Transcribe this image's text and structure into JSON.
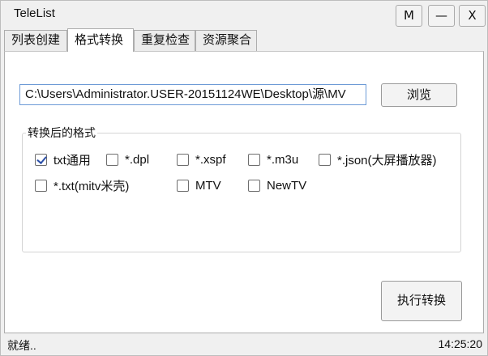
{
  "window": {
    "title": "TeleList",
    "buttons": {
      "m": "M",
      "minimize": "—",
      "close": "X"
    }
  },
  "tabs": [
    {
      "label": "列表创建",
      "active": false
    },
    {
      "label": "格式转换",
      "active": true
    },
    {
      "label": "重复检查",
      "active": false
    },
    {
      "label": "资源聚合",
      "active": false
    }
  ],
  "source": {
    "path_value": "C:\\Users\\Administrator.USER-20151124WE\\Desktop\\源\\MV",
    "browse_label": "浏览"
  },
  "formats": {
    "legend": "转换后的格式",
    "options": [
      {
        "label": "txt通用",
        "checked": true
      },
      {
        "label": "*.dpl",
        "checked": false
      },
      {
        "label": "*.xspf",
        "checked": false
      },
      {
        "label": "*.m3u",
        "checked": false
      },
      {
        "label": "*.json(大屏播放器)",
        "checked": false
      },
      {
        "label": "*.txt(mitv米壳)",
        "checked": false
      },
      {
        "label": "MTV",
        "checked": false
      },
      {
        "label": "NewTV",
        "checked": false
      }
    ]
  },
  "actions": {
    "execute_label": "执行转换"
  },
  "status": {
    "text": "就绪..",
    "time": "14:25:20"
  },
  "colors": {
    "input_border": "#6d9ad6",
    "check_mark": "#2b4fa8"
  }
}
